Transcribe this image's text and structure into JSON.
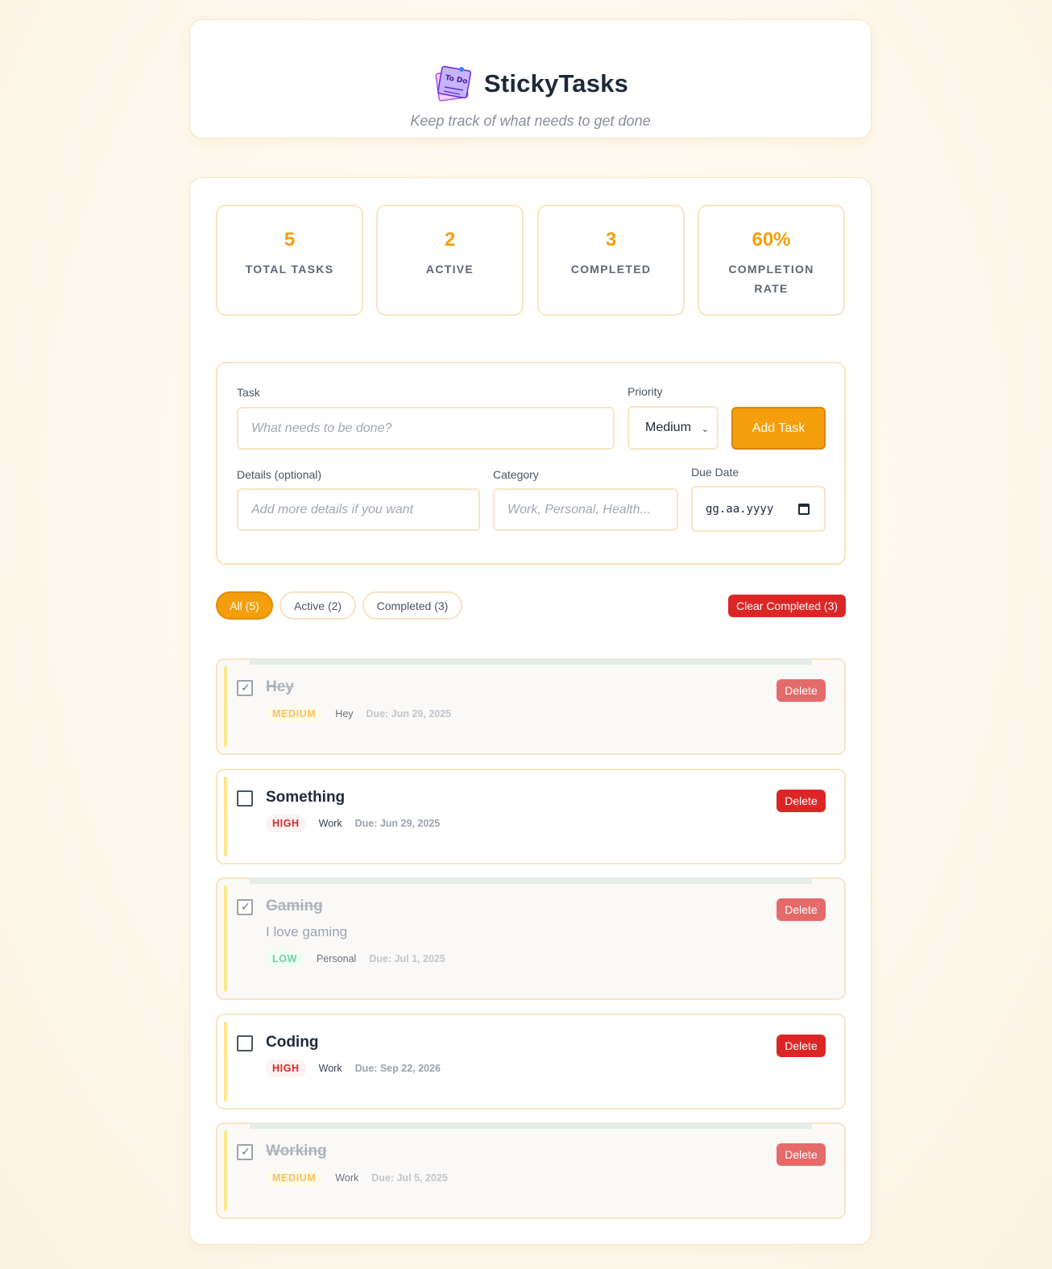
{
  "header": {
    "title": "StickyTasks",
    "subtitle": "Keep track of what needs to get done",
    "logo_icon": "sticky-note-todo-icon",
    "logo_text": "To Do"
  },
  "stats": [
    {
      "value": "5",
      "label": "TOTAL TASKS"
    },
    {
      "value": "2",
      "label": "ACTIVE"
    },
    {
      "value": "3",
      "label": "COMPLETED"
    },
    {
      "value": "60%",
      "label": "COMPLETION RATE"
    }
  ],
  "form": {
    "task_label": "Task",
    "task_placeholder": "What needs to be done?",
    "priority_label": "Priority",
    "priority_value": "Medium",
    "add_button": "Add Task",
    "details_label": "Details (optional)",
    "details_placeholder": "Add more details if you want",
    "category_label": "Category",
    "category_placeholder": "Work, Personal, Health...",
    "due_label": "Due Date",
    "due_placeholder": "gg.aa.yyyy"
  },
  "filters": {
    "all": "All (5)",
    "active": "Active (2)",
    "completed": "Completed (3)",
    "clear": "Clear Completed (3)"
  },
  "tasks": [
    {
      "title": "Hey",
      "description": "",
      "priority": "MEDIUM",
      "category": "Hey",
      "due": "Due: Jun 29, 2025",
      "completed": true,
      "delete": "Delete"
    },
    {
      "title": "Something",
      "description": "",
      "priority": "HIGH",
      "category": "Work",
      "due": "Due: Jun 29, 2025",
      "completed": false,
      "delete": "Delete"
    },
    {
      "title": "Gaming",
      "description": "I love gaming",
      "priority": "LOW",
      "category": "Personal",
      "due": "Due: Jul 1, 2025",
      "completed": true,
      "delete": "Delete"
    },
    {
      "title": "Coding",
      "description": "",
      "priority": "HIGH",
      "category": "Work",
      "due": "Due: Sep 22, 2026",
      "completed": false,
      "delete": "Delete"
    },
    {
      "title": "Working",
      "description": "",
      "priority": "MEDIUM",
      "category": "Work",
      "due": "Due: Jul 5, 2025",
      "completed": true,
      "delete": "Delete"
    }
  ],
  "colors": {
    "accent": "#f59e0b",
    "danger": "#dc2626",
    "border": "#f7e6c3"
  }
}
